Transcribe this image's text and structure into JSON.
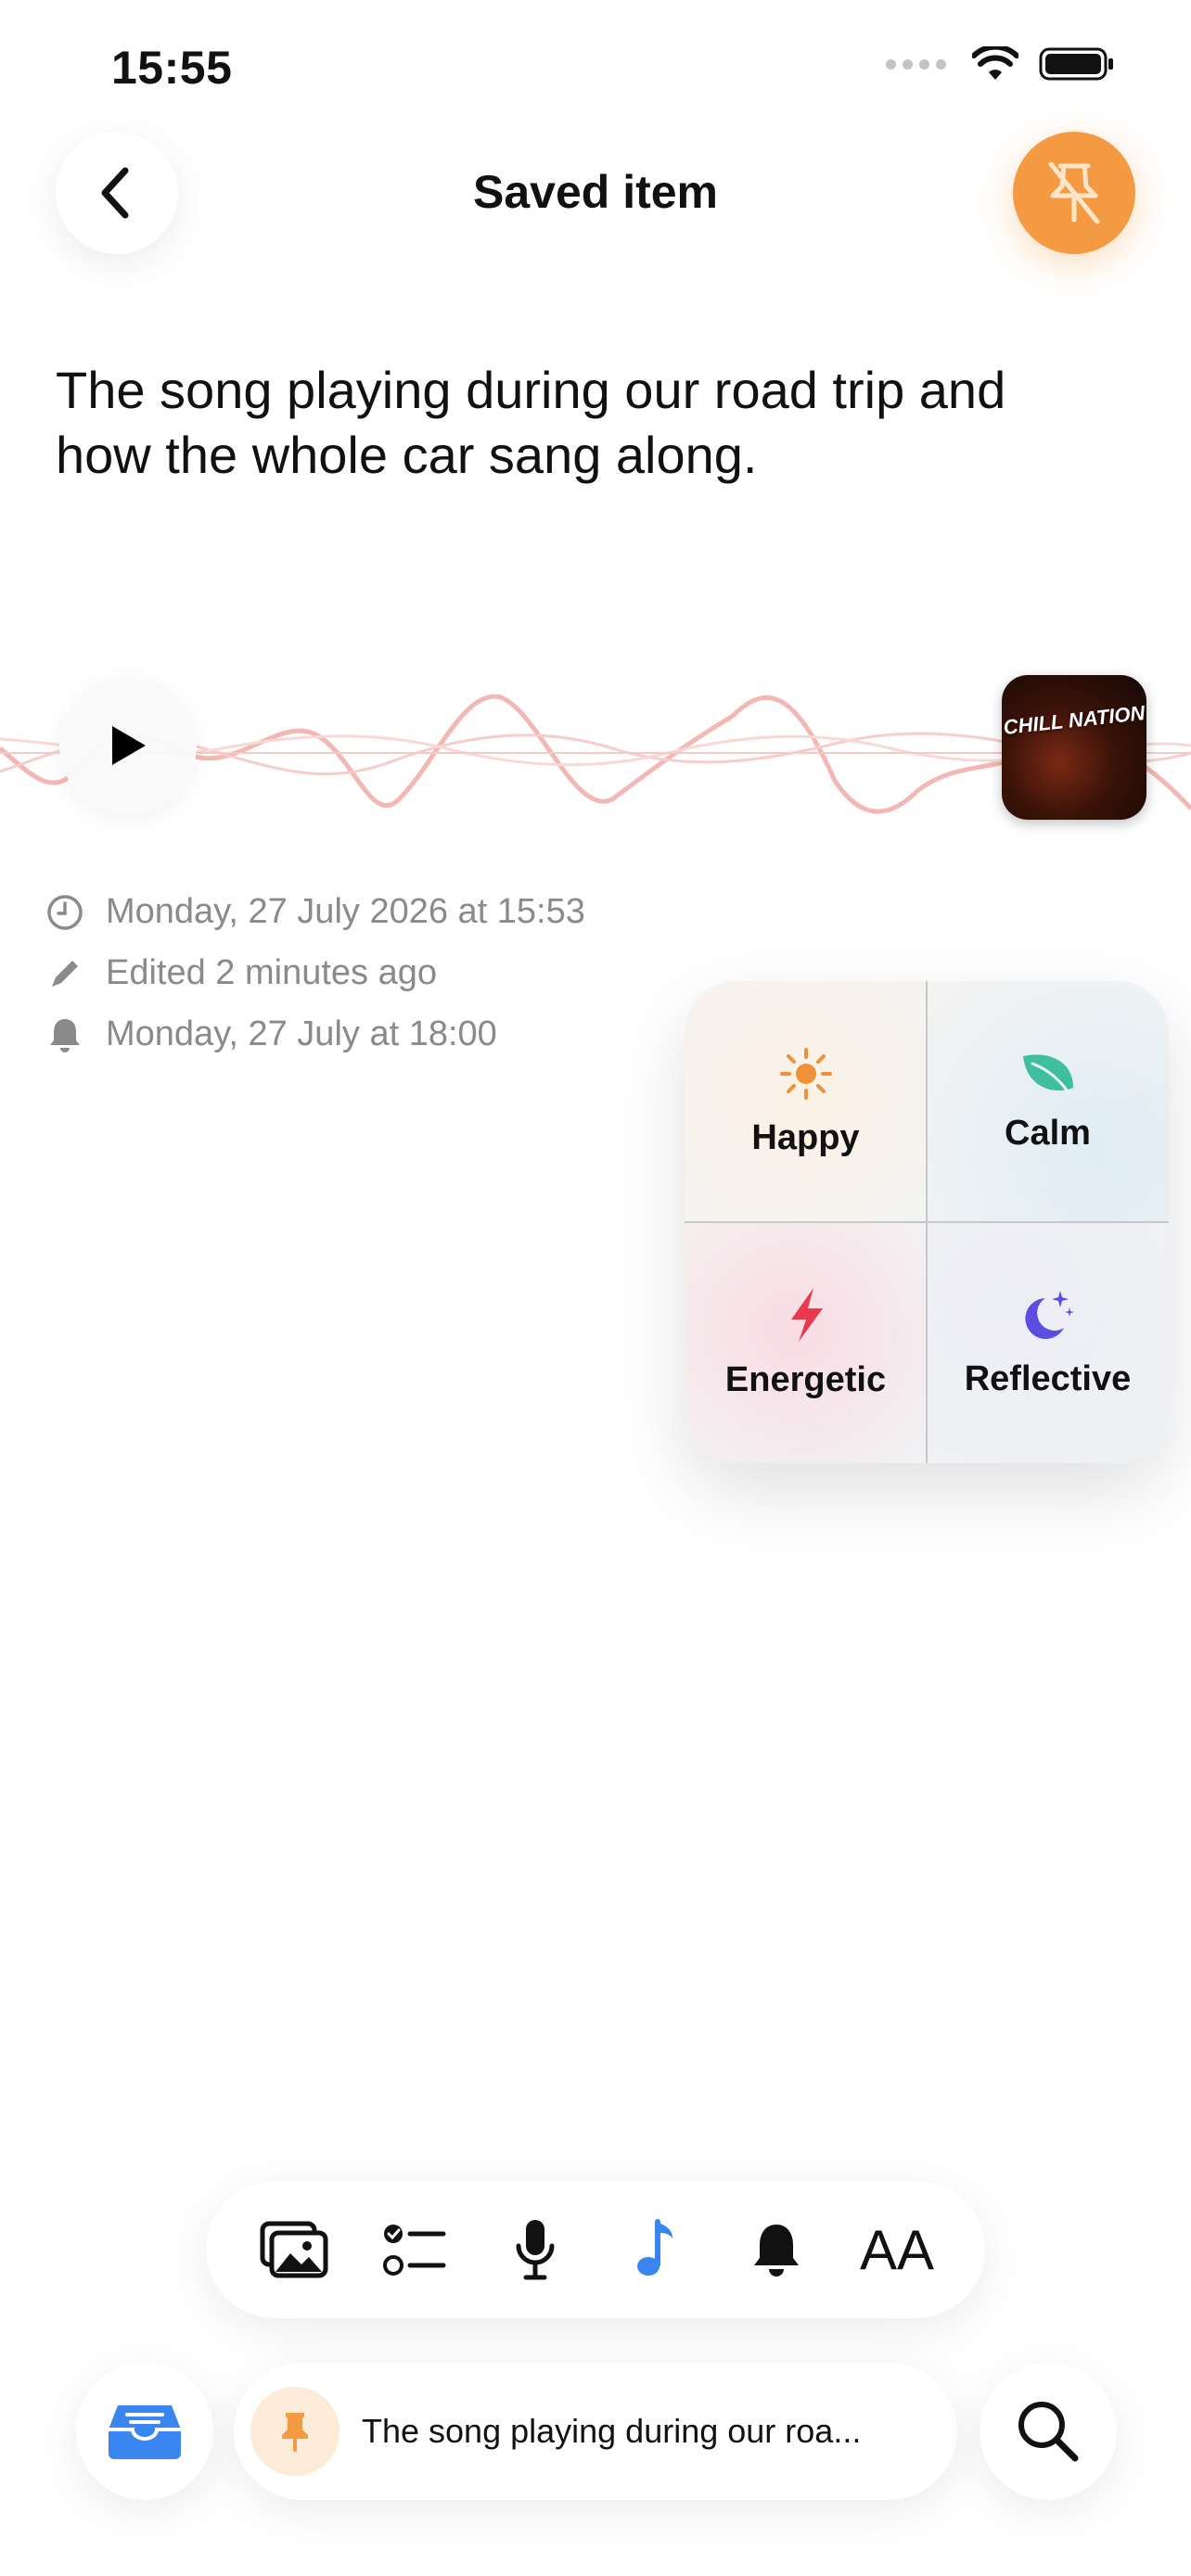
{
  "status_bar": {
    "time": "15:55"
  },
  "header": {
    "title": "Saved item"
  },
  "note": {
    "text": "The song playing during our road trip and how the whole car sang along."
  },
  "audio": {
    "album_title": "CHILL NATION"
  },
  "meta": {
    "created": "Monday, 27 July 2026 at 15:53",
    "edited": "Edited 2 minutes ago",
    "reminder": "Monday, 27 July at 18:00"
  },
  "moods": [
    {
      "label": "Happy",
      "icon": "sun-icon",
      "color": "#f0913a"
    },
    {
      "label": "Calm",
      "icon": "leaf-icon",
      "color": "#3fbfa0"
    },
    {
      "label": "Energetic",
      "icon": "bolt-icon",
      "color": "#e8394f"
    },
    {
      "label": "Reflective",
      "icon": "moon-stars-icon",
      "color": "#5b4ee0"
    }
  ],
  "toolbar": {
    "items": [
      "photos-icon",
      "checklist-icon",
      "microphone-icon",
      "music-note-icon",
      "bell-icon",
      "text-size-icon"
    ],
    "text_size_label": "AA",
    "active_color": "#3a86f0"
  },
  "bottom_bar": {
    "current_note": "The song playing during our roa..."
  },
  "colors": {
    "accent": "#f39a43",
    "inbox": "#3a86f0"
  }
}
